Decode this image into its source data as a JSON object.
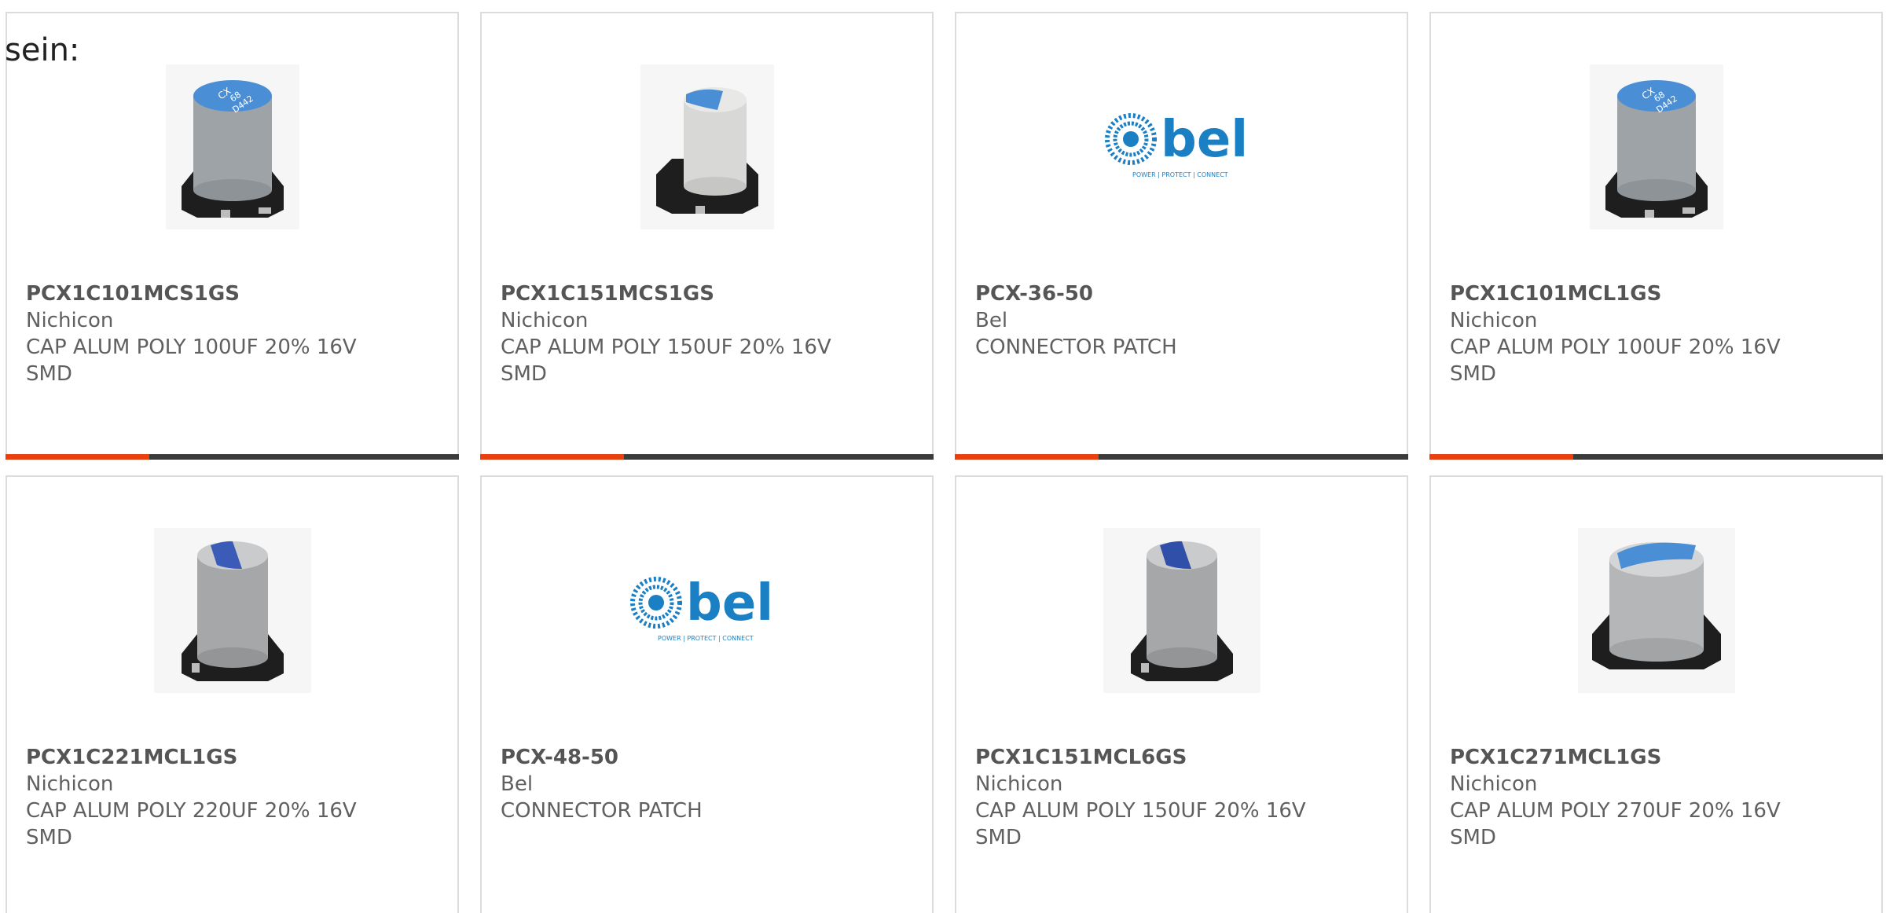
{
  "page": {
    "label": "sein:"
  },
  "colors": {
    "accent": "#e8400f",
    "bar": "#3b3b3b",
    "card_border": "#dcdcdc",
    "text": "#606060",
    "bel_blue": "#1b7fc4",
    "cap_stripe": "#4a8fd6"
  },
  "products": [
    {
      "part": "PCX1C101MCS1GS",
      "manufacturer": "Nichicon",
      "description": "CAP ALUM POLY 100UF 20% 16V\nSMD",
      "image": "capacitor-image"
    },
    {
      "part": "PCX1C151MCS1GS",
      "manufacturer": "Nichicon",
      "description": "CAP ALUM POLY 150UF 20% 16V\nSMD",
      "image": "capacitor-image"
    },
    {
      "part": "PCX-36-50",
      "manufacturer": "Bel",
      "description": "CONNECTOR PATCH",
      "image": "bel-logo"
    },
    {
      "part": "PCX1C101MCL1GS",
      "manufacturer": "Nichicon",
      "description": "CAP ALUM POLY 100UF 20% 16V\nSMD",
      "image": "capacitor-image"
    },
    {
      "part": "PCX1C221MCL1GS",
      "manufacturer": "Nichicon",
      "description": "CAP ALUM POLY 220UF 20% 16V\nSMD",
      "image": "capacitor-image"
    },
    {
      "part": "PCX-48-50",
      "manufacturer": "Bel",
      "description": "CONNECTOR PATCH",
      "image": "bel-logo"
    },
    {
      "part": "PCX1C151MCL6GS",
      "manufacturer": "Nichicon",
      "description": "CAP ALUM POLY 150UF 20% 16V\nSMD",
      "image": "capacitor-image"
    },
    {
      "part": "PCX1C271MCL1GS",
      "manufacturer": "Nichicon",
      "description": "CAP ALUM POLY 270UF 20% 16V\nSMD",
      "image": "capacitor-image"
    }
  ],
  "bel_logo": {
    "wordmark": "bel",
    "tagline": "POWER | PROTECT | CONNECT"
  },
  "capacitor_marking": {
    "line1": "CX",
    "line2": "68",
    "line3": "D442"
  }
}
